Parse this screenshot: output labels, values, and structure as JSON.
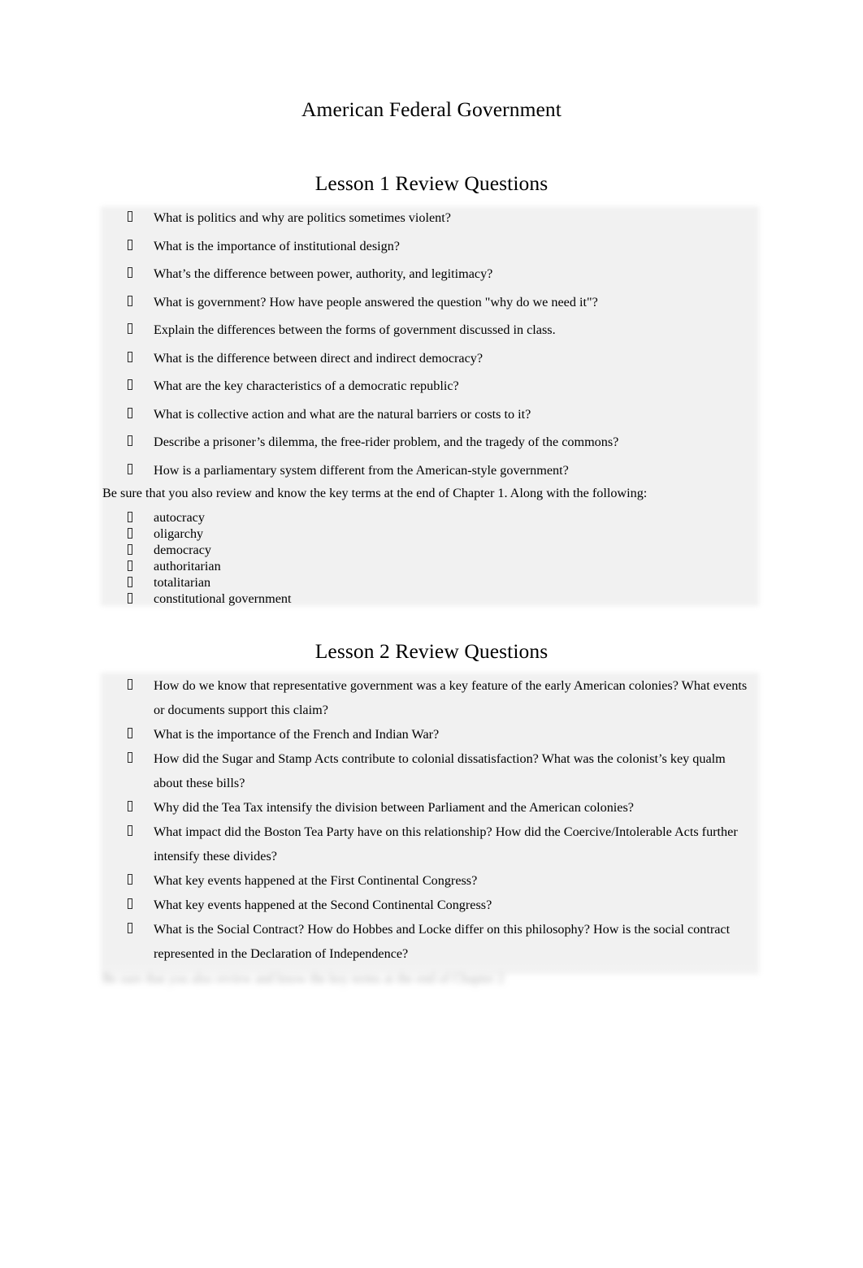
{
  "document": {
    "title": "American Federal Government",
    "bullet_glyph": "missing-glyph-box"
  },
  "lesson1": {
    "heading": "Lesson 1 Review Questions",
    "questions": [
      "What is politics and why are politics sometimes violent?",
      "What is the importance of institutional design?",
      "What’s the difference between power, authority, and legitimacy?",
      "What is government? How have people answered the question \"why do we need it\"?",
      "Explain the differences between the forms of government discussed in class.",
      "What is the difference between direct and indirect democracy?",
      "What are the key characteristics of a democratic republic?",
      "What is collective action and what are the natural barriers or costs to it?",
      "Describe a prisoner’s dilemma, the free-rider problem, and the tragedy of the commons?",
      "How is a parliamentary system different from the American-style government?"
    ],
    "terms_intro": "Be sure that you also review and know the key terms at the end of Chapter 1. Along with the following:",
    "key_terms": [
      "autocracy",
      "oligarchy",
      "democracy",
      "authoritarian",
      "totalitarian",
      "constitutional government"
    ]
  },
  "lesson2": {
    "heading": "Lesson 2 Review Questions",
    "questions": [
      "How do we know that representative government was a key feature of the early American colonies? What events or documents support this claim?",
      "What is the importance of the French and Indian War?",
      "How did the Sugar and Stamp Acts contribute to colonial dissatisfaction? What was the colonist’s key qualm about these bills?",
      "Why did the Tea Tax intensify the division between Parliament and the American colonies?",
      "What impact did the Boston Tea Party have on this relationship? How did the Coercive/Intolerable Acts further intensify these divides?",
      "What key events happened at the First Continental Congress?",
      "What key events happened at the Second Continental Congress?",
      "What is the Social Contract? How do Hobbes and Locke differ on this philosophy? How is the social contract represented in the Declaration of Independence?"
    ],
    "faded_trailing_line": "Be sure that you also review and know the key terms at the end of Chapter 2"
  },
  "styling": {
    "page_background": "#ffffff",
    "highlight_background": "#f1f1f1",
    "text_color": "#000000"
  }
}
